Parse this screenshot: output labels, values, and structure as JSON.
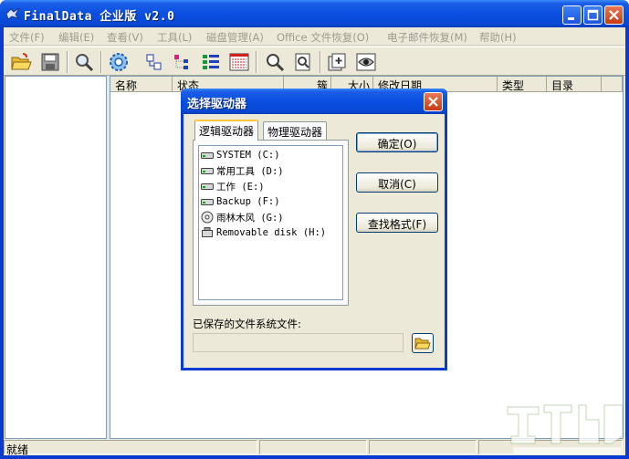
{
  "window": {
    "title": "FinalData 企业版 v2.0"
  },
  "menu": [
    {
      "label": "文件(F)"
    },
    {
      "label": "编辑(E)"
    },
    {
      "label": "查看(V)"
    },
    {
      "label": "工具(L)"
    },
    {
      "label": "磁盘管理(A)"
    },
    {
      "label": "Office 文件恢复(O)"
    },
    {
      "label": "电子邮件恢复(M)"
    },
    {
      "label": "帮助(H)"
    }
  ],
  "toolbar": {
    "icons": [
      "open-folder-icon",
      "save-icon",
      "search-icon",
      "gear-icon",
      "copy-icon",
      "tree-icon",
      "tree-list-icon",
      "list-icon",
      "find-icon",
      "find-file-icon",
      "add-icon",
      "preview-icon"
    ]
  },
  "file_list": {
    "columns": [
      "名称",
      "状态",
      "簇",
      "大小",
      "修改日期",
      "类型",
      "目录"
    ]
  },
  "status": {
    "text": "就绪"
  },
  "dialog": {
    "title": "选择驱动器",
    "tabs": [
      "逻辑驱动器",
      "物理驱动器"
    ],
    "drives": [
      {
        "label": "SYSTEM (C:)",
        "icon": "hard-drive-icon"
      },
      {
        "label": "常用工具 (D:)",
        "icon": "hard-drive-icon"
      },
      {
        "label": "工作 (E:)",
        "icon": "hard-drive-icon"
      },
      {
        "label": "Backup (F:)",
        "icon": "hard-drive-icon"
      },
      {
        "label": "雨林木风 (G:)",
        "icon": "cd-drive-icon"
      },
      {
        "label": "Removable disk (H:)",
        "icon": "removable-disk-icon"
      }
    ],
    "buttons": {
      "ok": "确定(O)",
      "cancel": "取消(C)",
      "find_format": "查找格式(F)"
    },
    "saved_label": "已保存的文件系统文件:",
    "saved_value": ""
  }
}
